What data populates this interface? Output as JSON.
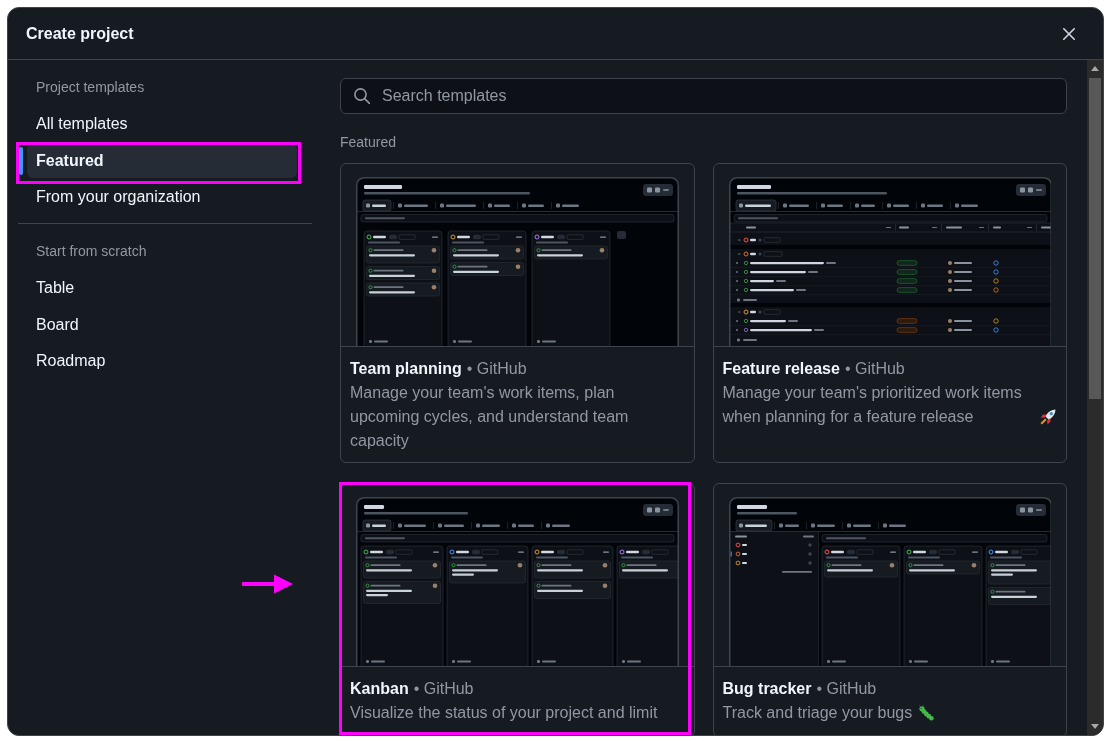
{
  "dialog": {
    "title": "Create project"
  },
  "sidebar": {
    "groups": [
      {
        "heading": "Project templates",
        "items": [
          {
            "label": "All templates",
            "selected": false,
            "highlighted": false
          },
          {
            "label": "Featured",
            "selected": true,
            "highlighted": true
          },
          {
            "label": "From your organization",
            "selected": false,
            "highlighted": false
          }
        ]
      },
      {
        "heading": "Start from scratch",
        "items": [
          {
            "label": "Table",
            "selected": false,
            "highlighted": false
          },
          {
            "label": "Board",
            "selected": false,
            "highlighted": false
          },
          {
            "label": "Roadmap",
            "selected": false,
            "highlighted": false
          }
        ]
      }
    ]
  },
  "search": {
    "placeholder": "Search templates"
  },
  "featured": {
    "heading": "Featured",
    "templates": [
      {
        "title": "Team planning",
        "byline": "• GitHub",
        "description": "Manage your team's work items, plan upcoming cycles, and understand team capacity",
        "preview": {
          "kind": "planning_board"
        },
        "highlighted": false,
        "arrow": false
      },
      {
        "title": "Feature release",
        "byline": "• GitHub",
        "description": "Manage your team's prioritized work items when planning for a feature release",
        "emoji": {
          "kind": "rocket"
        },
        "preview": {
          "kind": "release_table"
        },
        "highlighted": false,
        "arrow": false
      },
      {
        "title": "Kanban",
        "byline": "• GitHub",
        "description": "Visualize the status of your project and limit",
        "preview": {
          "kind": "kanban_board"
        },
        "highlighted": true,
        "arrow": true
      },
      {
        "title": "Bug tracker",
        "byline": "• GitHub",
        "description": "Track and triage your bugs",
        "emoji": {
          "kind": "caterpillar"
        },
        "preview": {
          "kind": "bug_board"
        },
        "highlighted": false,
        "arrow": false
      }
    ]
  }
}
